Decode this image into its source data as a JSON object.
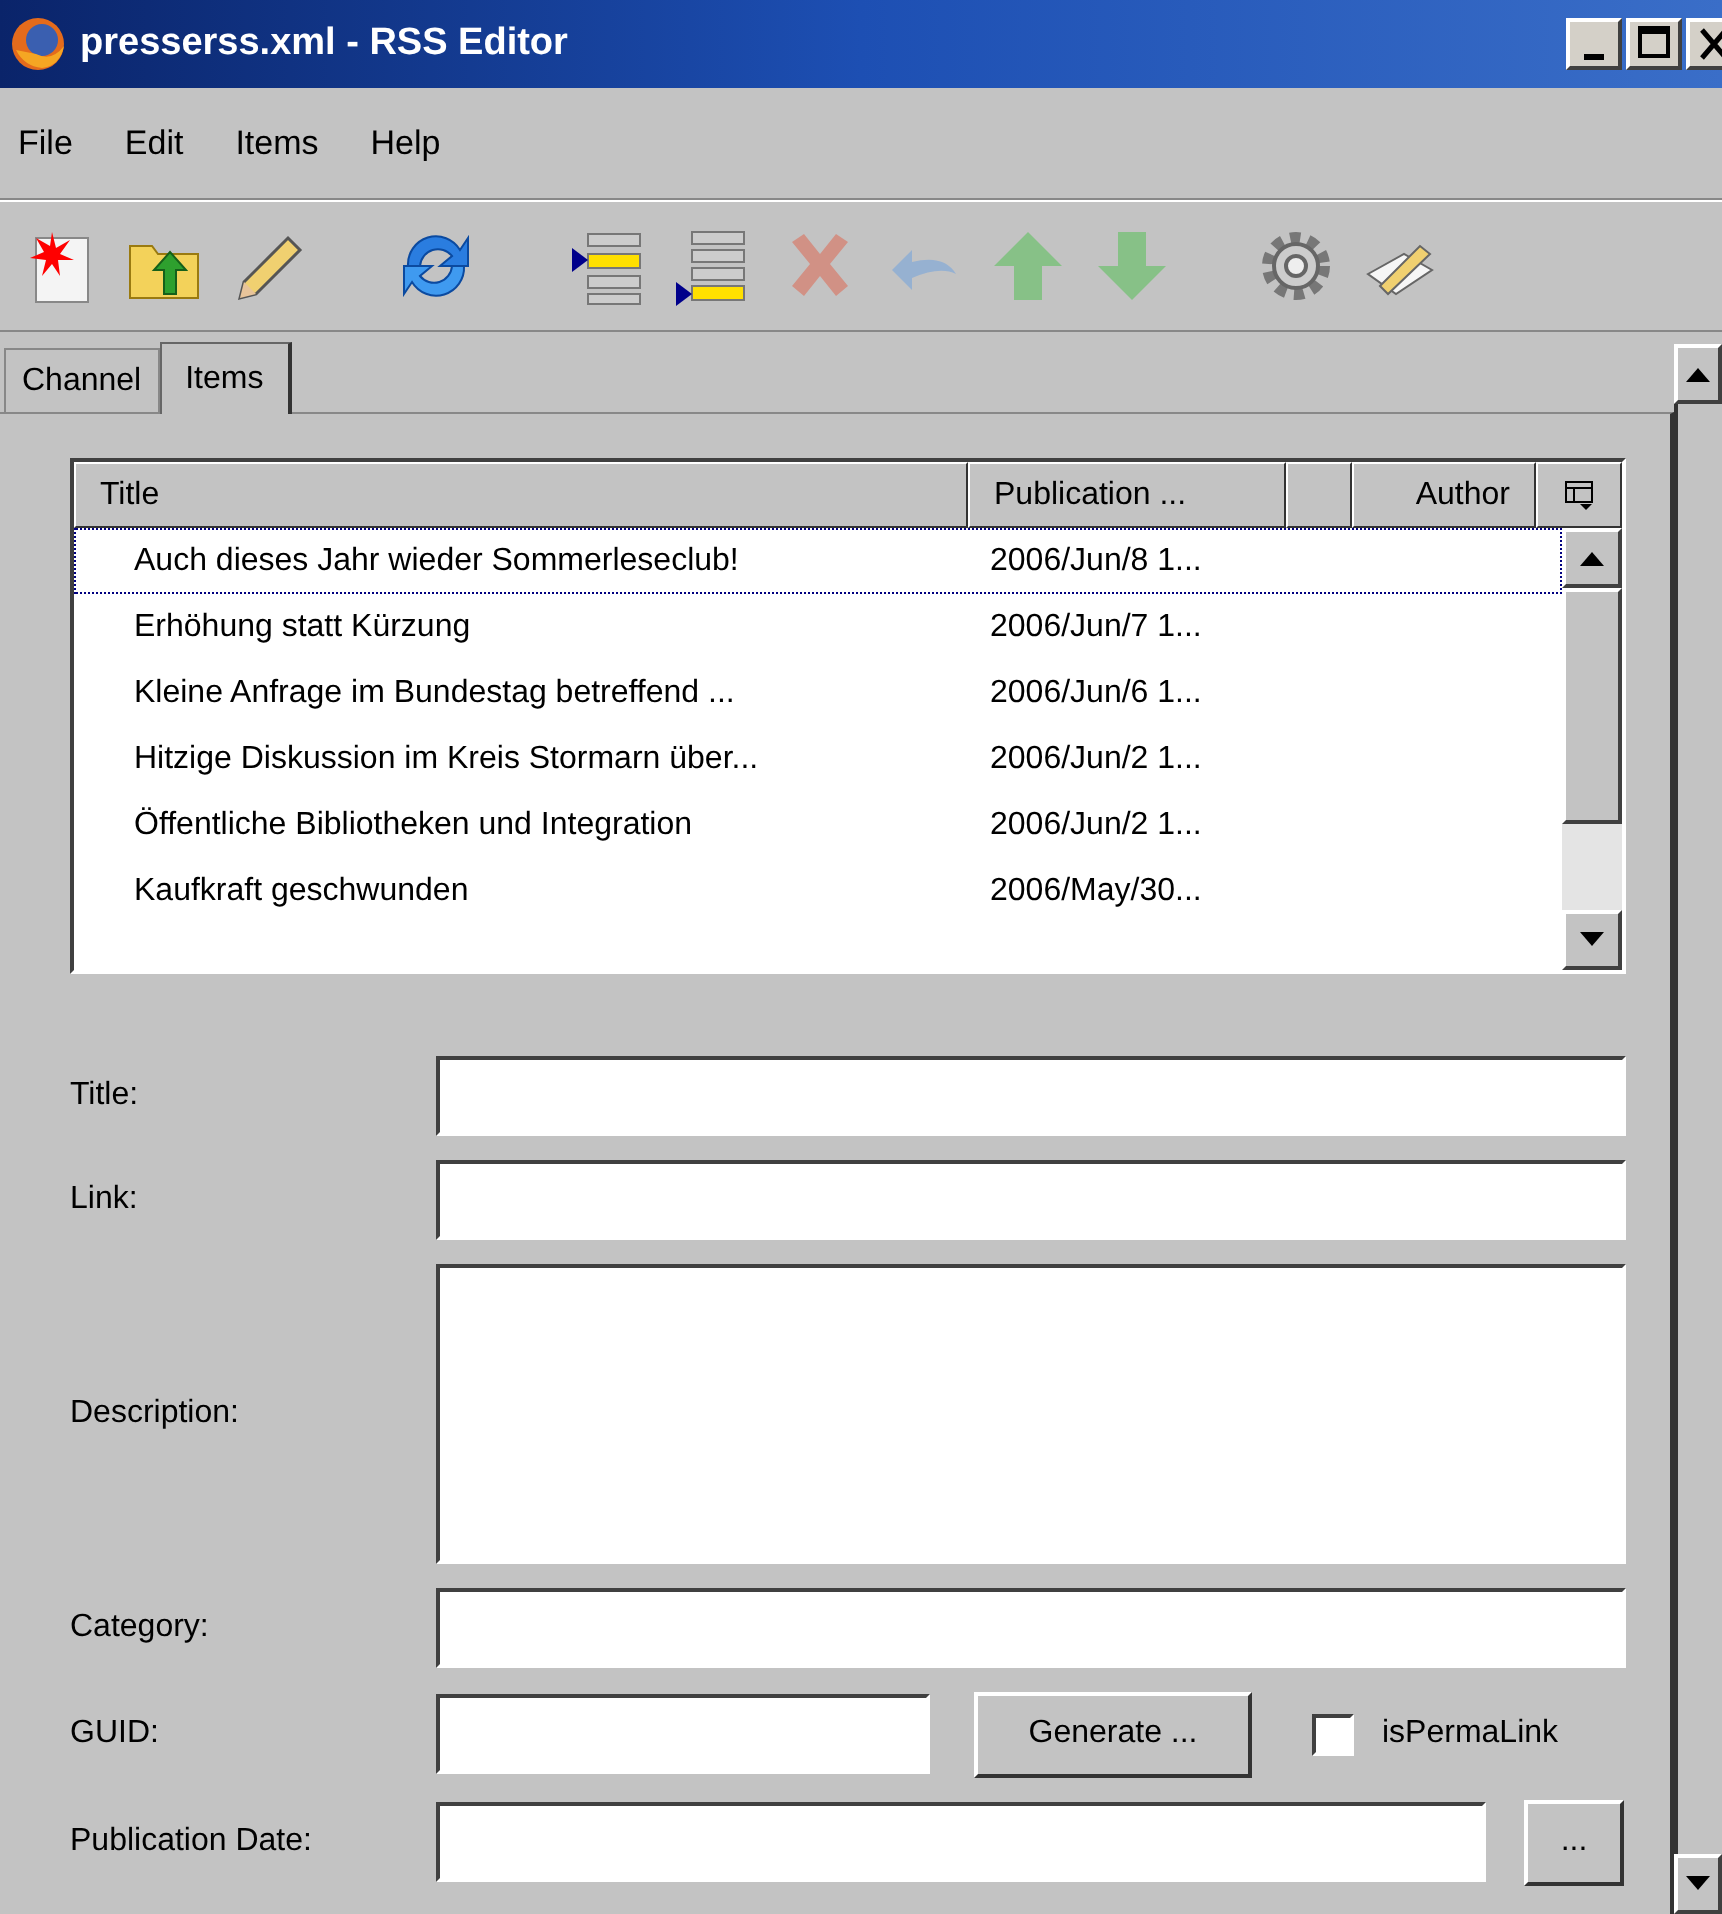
{
  "window": {
    "title": "presserss.xml - RSS Editor",
    "controls": [
      {
        "kind": "minimize"
      },
      {
        "kind": "maximize"
      },
      {
        "kind": "close"
      }
    ]
  },
  "menu": [
    "File",
    "Edit",
    "Items",
    "Help"
  ],
  "toolbar": [
    {
      "kind": "new",
      "disabled": false
    },
    {
      "kind": "open",
      "disabled": false
    },
    {
      "kind": "edit",
      "disabled": false
    },
    {
      "kind": "refresh",
      "disabled": false
    },
    {
      "kind": "indent",
      "disabled": false
    },
    {
      "kind": "append",
      "disabled": false
    },
    {
      "kind": "delete",
      "disabled": true
    },
    {
      "kind": "undo",
      "disabled": true
    },
    {
      "kind": "up",
      "disabled": true
    },
    {
      "kind": "down",
      "disabled": true
    },
    {
      "kind": "settings",
      "disabled": false
    },
    {
      "kind": "tools",
      "disabled": false
    }
  ],
  "tabs": [
    {
      "label": "Channel",
      "selected": false
    },
    {
      "label": "Items",
      "selected": true
    }
  ],
  "table": {
    "columns": [
      "Title",
      "Publication ...",
      "Author"
    ],
    "rows": [
      {
        "title": "Auch dieses Jahr wieder Sommerleseclub!",
        "date": "2006/Jun/8 1...",
        "focused": true
      },
      {
        "title": "Erhöhung statt Kürzung",
        "date": "2006/Jun/7 1...",
        "focused": false
      },
      {
        "title": "Kleine Anfrage im Bundestag betreffend ...",
        "date": "2006/Jun/6 1...",
        "focused": false
      },
      {
        "title": "Hitzige Diskussion im Kreis Stormarn über...",
        "date": "2006/Jun/2 1...",
        "focused": false
      },
      {
        "title": "Öffentliche Bibliotheken und Integration",
        "date": "2006/Jun/2 1...",
        "focused": false
      },
      {
        "title": "Kaufkraft geschwunden",
        "date": "2006/May/30...",
        "focused": false
      }
    ]
  },
  "form": {
    "title": {
      "label": "Title:"
    },
    "link": {
      "label": "Link:"
    },
    "description": {
      "label": "Description:"
    },
    "category": {
      "label": "Category:"
    },
    "guid": {
      "label": "GUID:",
      "button": "Generate ...",
      "checkbox": {
        "label": "isPermaLink",
        "checked": false
      }
    },
    "publication_date": {
      "label": "Publication Date:",
      "button": "..."
    }
  }
}
